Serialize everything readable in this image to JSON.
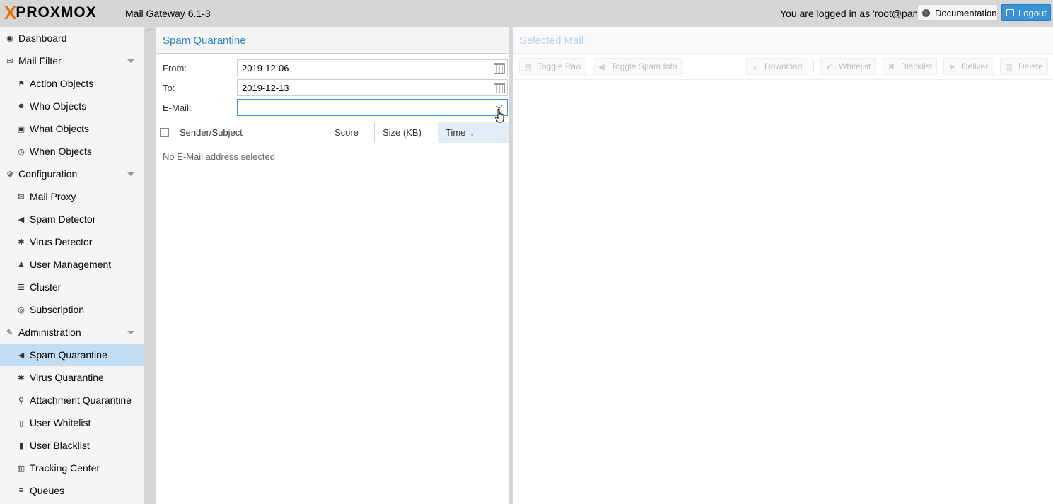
{
  "header": {
    "logo_x": "X",
    "logo_word": "PROXMOX",
    "product": "Mail Gateway 6.1-3",
    "login_text": "You are logged in as 'root@pam'",
    "documentation_label": "Documentation",
    "logout_label": "Logout",
    "logo_color": "#e57000",
    "accent": "#3892d4"
  },
  "sidebar": {
    "items": [
      {
        "label": "Dashboard",
        "icon": "dashboard-icon",
        "glyph": "◉",
        "level": 0
      },
      {
        "label": "Mail Filter",
        "icon": "envelope-icon",
        "glyph": "✉",
        "level": 0,
        "expandable": true
      },
      {
        "label": "Action Objects",
        "icon": "flag-icon",
        "glyph": "⚑",
        "level": 1
      },
      {
        "label": "Who Objects",
        "icon": "user-circle-icon",
        "glyph": "☻",
        "level": 1
      },
      {
        "label": "What Objects",
        "icon": "cube-icon",
        "glyph": "▣",
        "level": 1
      },
      {
        "label": "When Objects",
        "icon": "clock-icon",
        "glyph": "◷",
        "level": 1
      },
      {
        "label": "Configuration",
        "icon": "cogs-icon",
        "glyph": "⚙",
        "level": 0,
        "expandable": true
      },
      {
        "label": "Mail Proxy",
        "icon": "envelope-outline-icon",
        "glyph": "✉",
        "level": 1
      },
      {
        "label": "Spam Detector",
        "icon": "bullhorn-icon",
        "glyph": "◀",
        "level": 1
      },
      {
        "label": "Virus Detector",
        "icon": "bug-icon",
        "glyph": "✱",
        "level": 1
      },
      {
        "label": "User Management",
        "icon": "users-icon",
        "glyph": "♟",
        "level": 1
      },
      {
        "label": "Cluster",
        "icon": "server-icon",
        "glyph": "☰",
        "level": 1
      },
      {
        "label": "Subscription",
        "icon": "support-icon",
        "glyph": "◎",
        "level": 1
      },
      {
        "label": "Administration",
        "icon": "wrench-icon",
        "glyph": "✎",
        "level": 0,
        "expandable": true
      },
      {
        "label": "Spam Quarantine",
        "icon": "bullhorn-icon",
        "glyph": "◀",
        "level": 1,
        "selected": true
      },
      {
        "label": "Virus Quarantine",
        "icon": "bug-icon",
        "glyph": "✱",
        "level": 1
      },
      {
        "label": "Attachment Quarantine",
        "icon": "paperclip-icon",
        "glyph": "⚲",
        "level": 1
      },
      {
        "label": "User Whitelist",
        "icon": "file-outline-icon",
        "glyph": "▯",
        "level": 1
      },
      {
        "label": "User Blacklist",
        "icon": "file-icon",
        "glyph": "▮",
        "level": 1
      },
      {
        "label": "Tracking Center",
        "icon": "map-icon",
        "glyph": "▥",
        "level": 1
      },
      {
        "label": "Queues",
        "icon": "bars-icon",
        "glyph": "≡",
        "level": 1
      }
    ]
  },
  "quarantine": {
    "title": "Spam Quarantine",
    "from_label": "From:",
    "from_value": "2019-12-06",
    "to_label": "To:",
    "to_value": "2019-12-13",
    "email_label": "E-Mail:",
    "email_value": "",
    "columns": {
      "sender_subject": "Sender/Subject",
      "score": "Score",
      "size": "Size (KB)",
      "time": "Time"
    },
    "sort_arrow": "↓",
    "empty_text": "No E-Mail address selected"
  },
  "mail": {
    "title": "Selected Mail",
    "toolbar": {
      "toggle_raw": "Toggle Raw",
      "toggle_spam_info": "Toggle Spam Info",
      "download": "Download",
      "whitelist": "Whitelist",
      "blacklist": "Blacklist",
      "deliver": "Deliver",
      "delete": "Delete"
    }
  }
}
